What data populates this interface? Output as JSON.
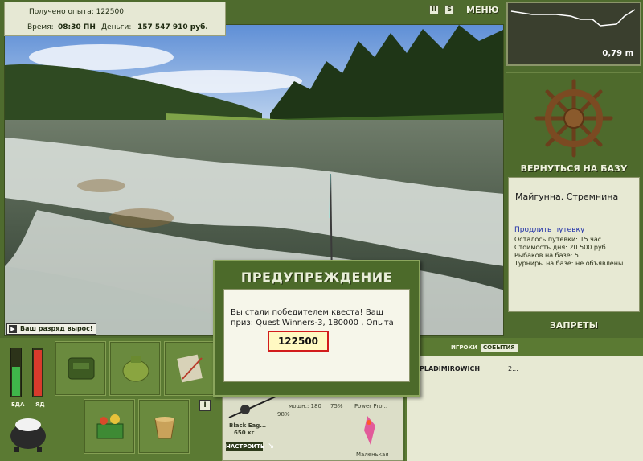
{
  "top_info": {
    "exp_line": "Получено опыта: 122500",
    "time_label": "Время:",
    "time_value": "08:30 ПН",
    "money_label": "Деньги:",
    "money_value": "157 547 910 руб."
  },
  "top_buttons": {
    "pause": "II",
    "sound": "S",
    "menu": "МЕНЮ"
  },
  "scene": {
    "rank_badge": "Ваш разряд вырос!"
  },
  "depth": {
    "value": "0,79 m"
  },
  "base": {
    "return_label": "ВЕРНУТЬСЯ НА БАЗУ",
    "name": "Майгунна. Стремнина",
    "extend_link": "Продлить путевку",
    "stats": [
      "Осталось путевки: 15 час.",
      "Стоимость дня: 20 500 руб.",
      "Рыбаков на базе: 5",
      "Турниры на базе: не объявлены"
    ],
    "bans_label": "ЗАПРЕТЫ"
  },
  "gauges": {
    "food_label": "ЕДА",
    "poison_label": "ЯД",
    "food_level": 0.6,
    "poison_level": 0.95
  },
  "inventory": {
    "items": [
      "backpack-icon",
      "fishing-bag-icon",
      "notebook-icon",
      "food-basket-icon",
      "bucket-icon",
      "pot-icon"
    ]
  },
  "rod": {
    "name": "Black Eag...",
    "weight": "650 кг",
    "percent": "98%",
    "power_label": "мощн.: 180",
    "power_pct": "75%",
    "reel_label": "Power Pro...",
    "lure_label": "Маленькая",
    "setup_button": "НАСТРОИТЬ"
  },
  "players": {
    "tab_players": "ИГРОКИ",
    "tab_events": "СОБЫТИЯ",
    "rows": [
      {
        "name": "PLADIMIROWICH",
        "value": "2..."
      }
    ]
  },
  "dialog": {
    "title": "ПРЕДУПРЕЖДЕНИЕ",
    "message": "Вы стали победителем квеста! Ваш приз: Quest Winners-3, 180000 , Опыта",
    "prize": "122500"
  },
  "colors": {
    "panel_green": "#4f6b2e",
    "accent_red": "#d21c1c",
    "light_panel": "#e7e9d3"
  }
}
